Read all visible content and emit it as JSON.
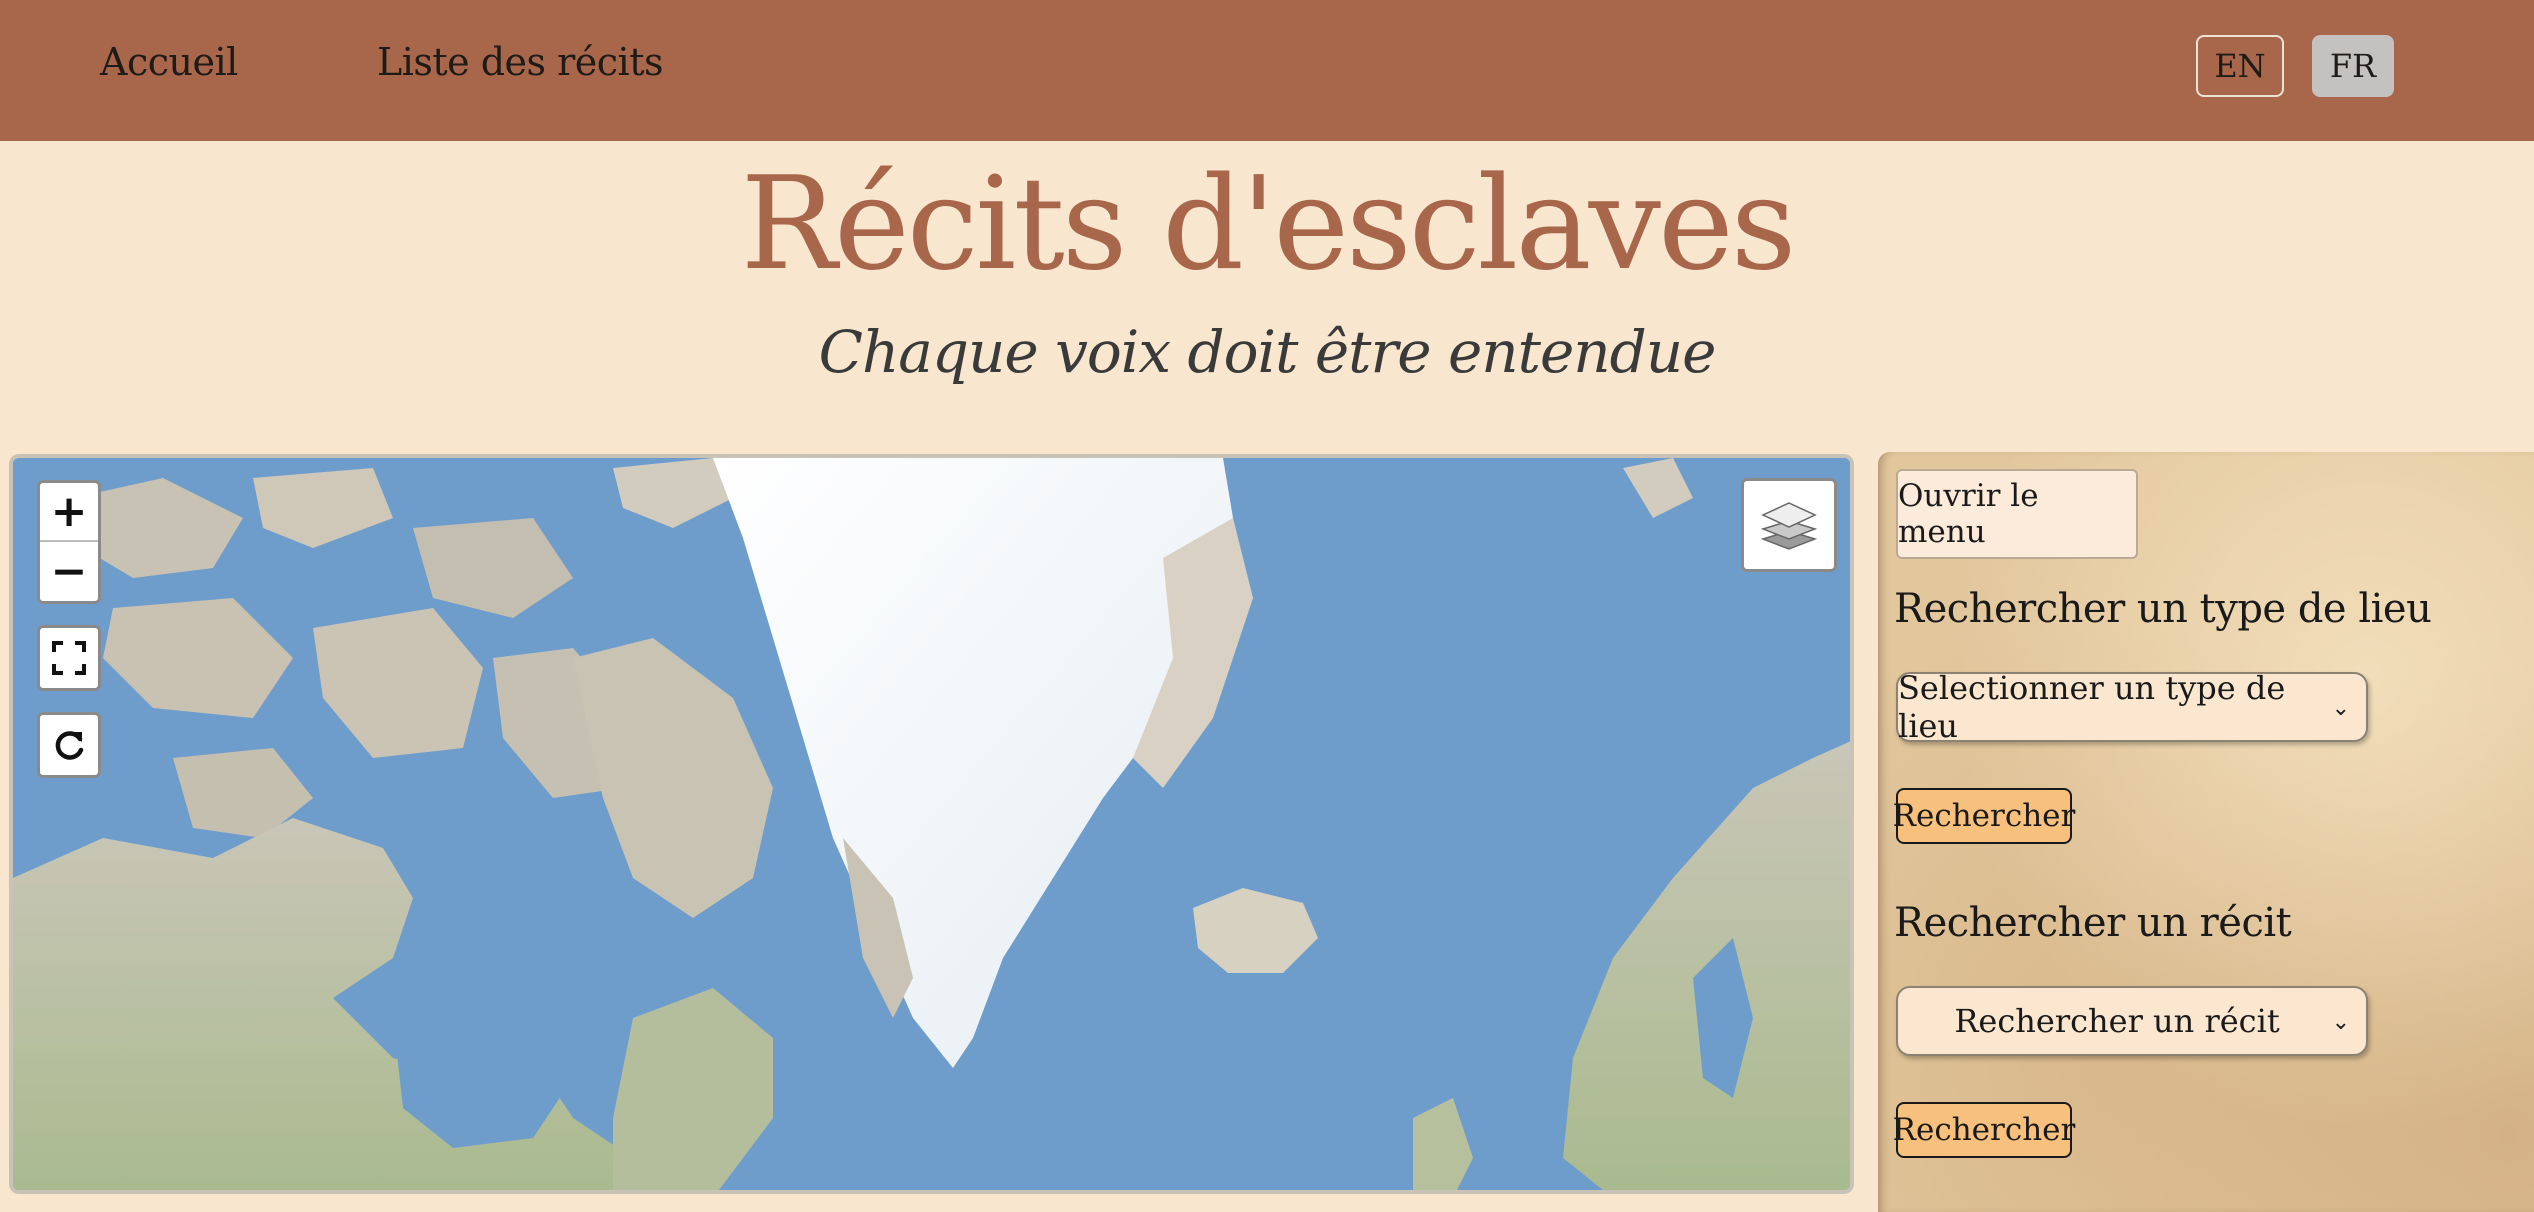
{
  "nav": {
    "home": "Accueil",
    "list": "Liste des récits",
    "lang_en": "EN",
    "lang_fr": "FR"
  },
  "header": {
    "title": "Récits d'esclaves",
    "subtitle": "Chaque voix doit être entendue"
  },
  "map": {
    "zoom_in": "+",
    "zoom_out": "−"
  },
  "panel": {
    "menu_button": "Ouvrir le menu",
    "place_type_heading": "Rechercher un type de lieu",
    "place_type_select": "Selectionner un type de lieu",
    "place_type_search": "Rechercher",
    "recit_heading": "Rechercher un récit",
    "recit_select": "Rechercher un récit",
    "recit_search": "Rechercher"
  },
  "colors": {
    "navbar": "#a8664b",
    "page_bg": "#f8e6cf",
    "title": "#a8664b",
    "search_button": "#f8c07d",
    "ocean": "#6e9dcc"
  }
}
